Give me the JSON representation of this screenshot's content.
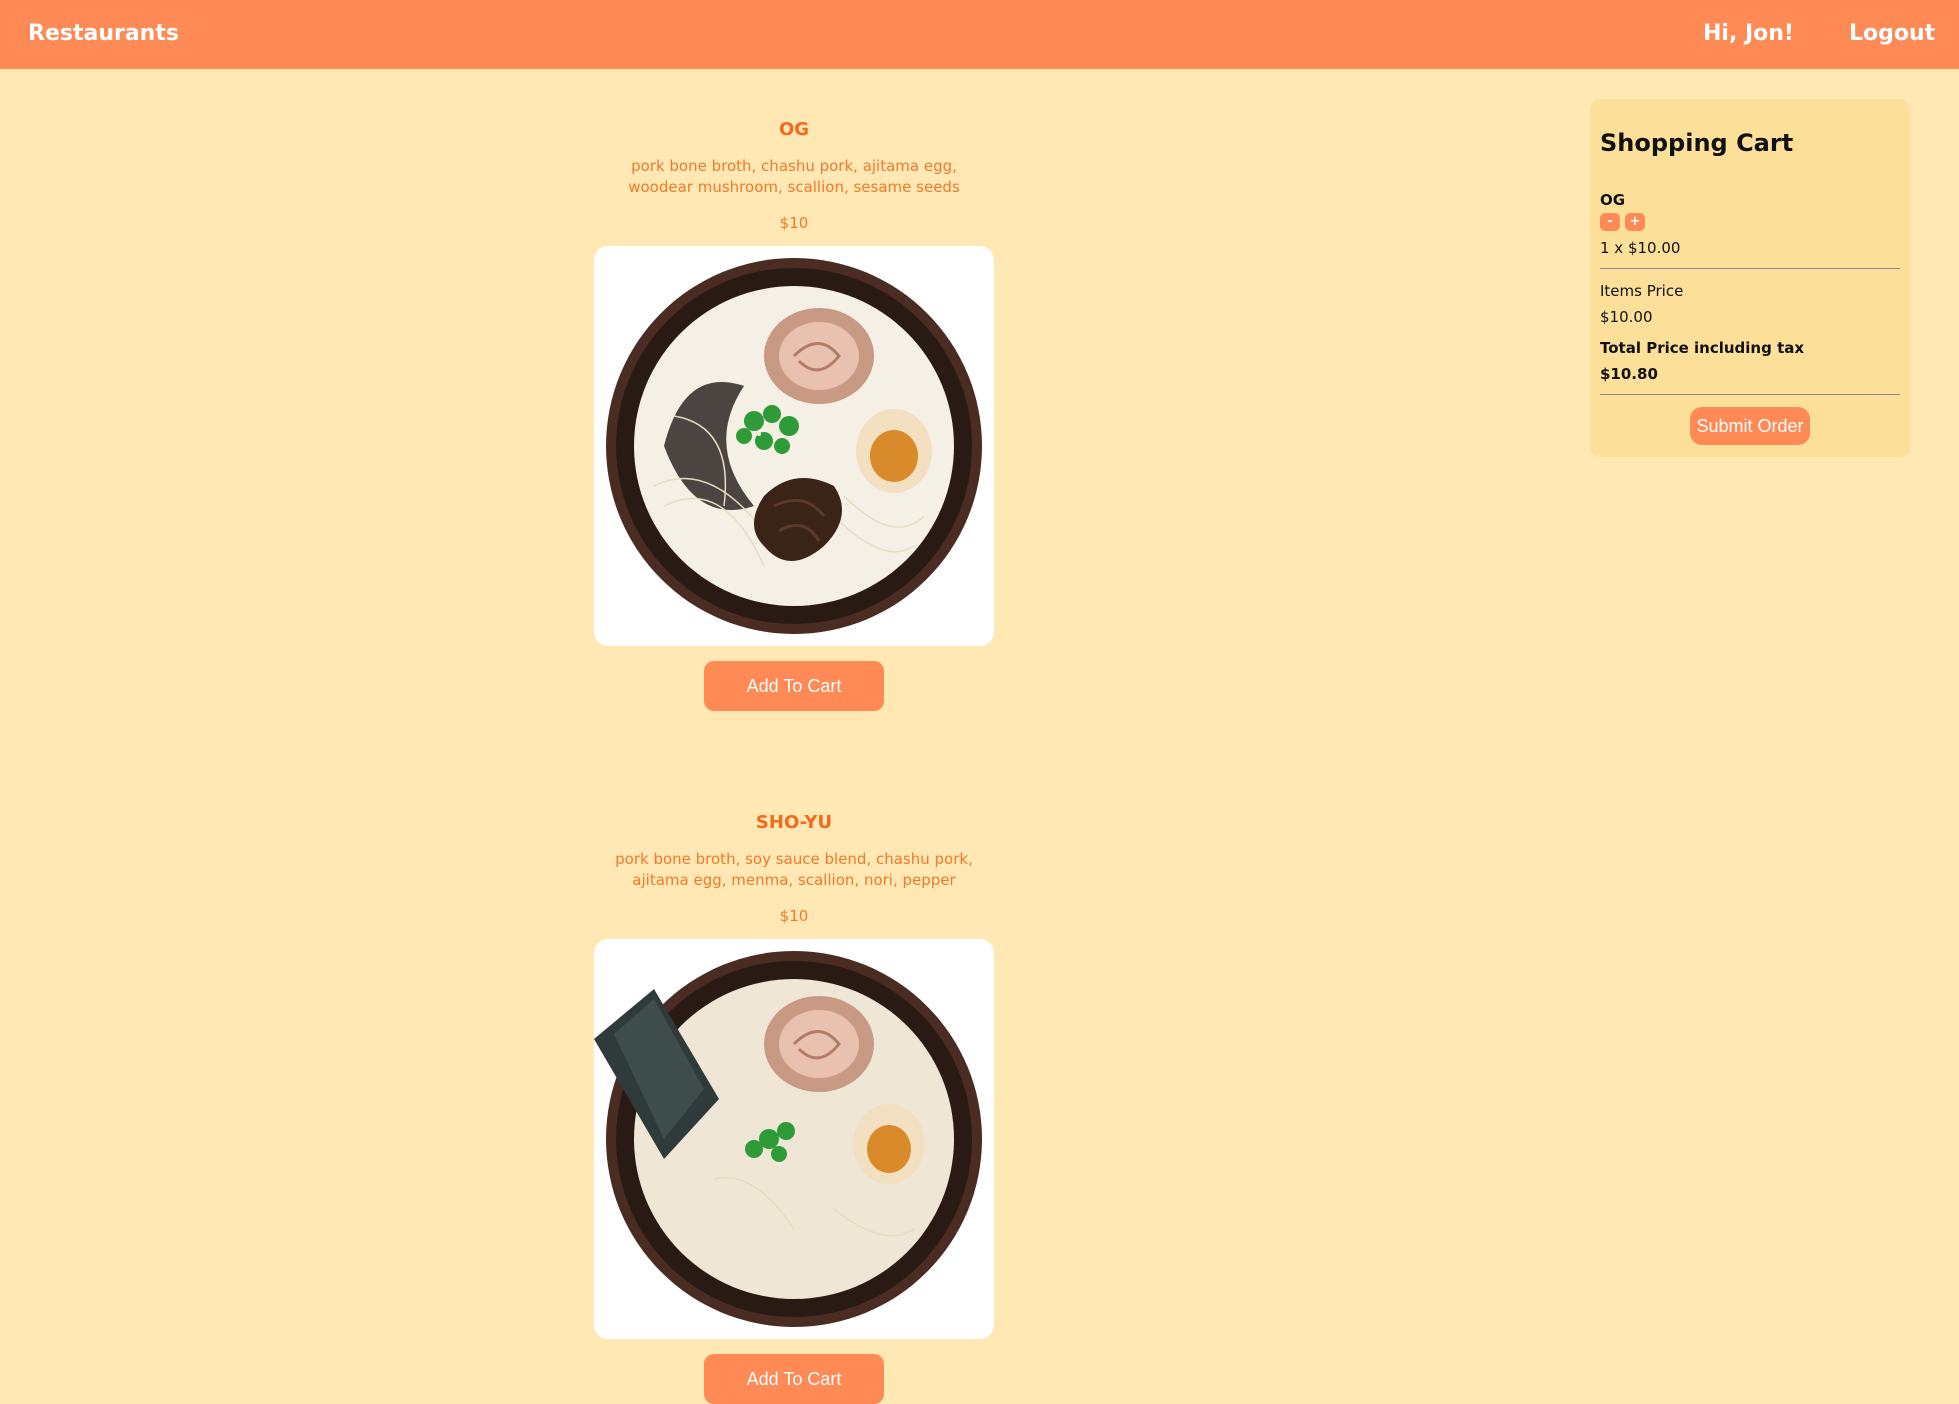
{
  "nav": {
    "brand": "Restaurants",
    "greeting": "Hi, Jon!",
    "logout": "Logout"
  },
  "menu": {
    "items": [
      {
        "name": "OG",
        "description": "pork bone broth, chashu pork, ajitama egg, woodear mushroom, scallion, sesame seeds",
        "price": "$10",
        "add_label": "Add To Cart"
      },
      {
        "name": "SHO-YU",
        "description": "pork bone broth, soy sauce blend, chashu pork, ajitama egg, menma, scallion, nori, pepper",
        "price": "$10",
        "add_label": "Add To Cart"
      }
    ]
  },
  "cart": {
    "title": "Shopping Cart",
    "lines": [
      {
        "name": "OG",
        "minus": "-",
        "plus": "+",
        "qty_text": "1 x $10.00"
      }
    ],
    "items_price_label": "Items Price",
    "items_price": "$10.00",
    "total_label": "Total Price including tax",
    "total": "$10.80",
    "submit_label": "Submit Order"
  },
  "colors": {
    "accent": "#ff8a55",
    "background": "#ffe8b3",
    "cart_bg": "#fce09a",
    "item_text": "#f26a1b"
  }
}
